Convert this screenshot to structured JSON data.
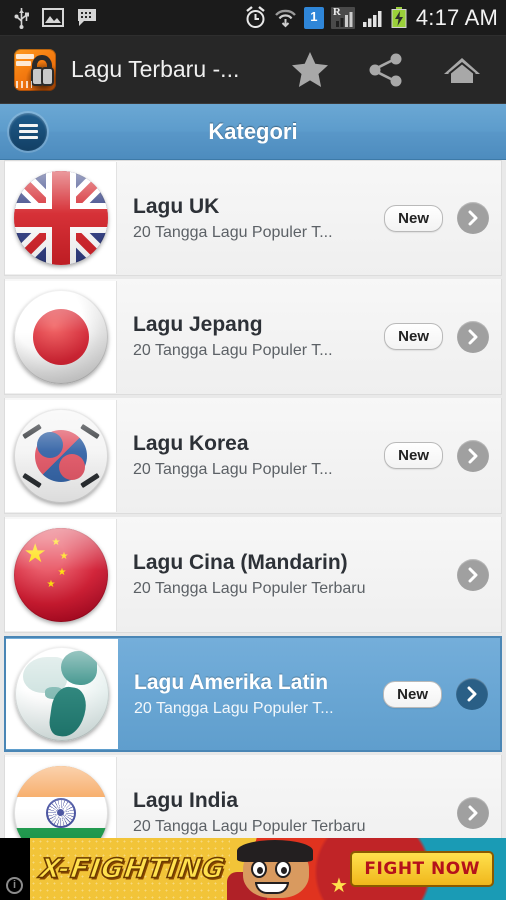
{
  "status_bar": {
    "time": "4:17 AM",
    "sim_badge": "1",
    "roaming_label": "R",
    "icons": [
      "usb-icon",
      "image-icon",
      "message-icon",
      "alarm-icon",
      "wifi-icon",
      "sim-icon",
      "roaming-signal-icon",
      "signal-icon",
      "battery-charging-icon"
    ]
  },
  "action_bar": {
    "app_title": "Lagu Terbaru -...",
    "app_icon_name": "app-logo-icon",
    "actions": [
      {
        "name": "favorite-star-button",
        "icon": "star-icon"
      },
      {
        "name": "share-button",
        "icon": "share-icon"
      },
      {
        "name": "home-button",
        "icon": "home-icon"
      }
    ]
  },
  "title_bar": {
    "title": "Kategori",
    "menu_button_label": "menu-icon"
  },
  "list": {
    "badge_label": "New",
    "items": [
      {
        "title": "Lagu UK",
        "subtitle": "20 Tangga Lagu Populer T...",
        "flag": "uk-flag-icon",
        "new": true,
        "selected": false
      },
      {
        "title": "Lagu Jepang",
        "subtitle": "20 Tangga Lagu Populer T...",
        "flag": "japan-flag-icon",
        "new": true,
        "selected": false
      },
      {
        "title": "Lagu Korea",
        "subtitle": "20 Tangga Lagu Populer T...",
        "flag": "korea-flag-icon",
        "new": true,
        "selected": false
      },
      {
        "title": "Lagu Cina (Mandarin)",
        "subtitle": "20 Tangga Lagu Populer Terbaru",
        "flag": "china-flag-icon",
        "new": false,
        "selected": false
      },
      {
        "title": "Lagu Amerika Latin",
        "subtitle": "20 Tangga Lagu Populer T...",
        "flag": "latin-america-globe-icon",
        "new": true,
        "selected": true
      },
      {
        "title": "Lagu India",
        "subtitle": "20 Tangga Lagu Populer Terbaru",
        "flag": "india-flag-icon",
        "new": false,
        "selected": false
      }
    ]
  },
  "ad_banner": {
    "logo_text": "X-FIGHTING",
    "cta_label": "FIGHT NOW",
    "info_label": "i"
  },
  "colors": {
    "title_bar_blue": "#5997c8",
    "selected_row_blue": "#5f9ecd",
    "accent_orange": "#f47b10",
    "status_bar_dark": "#1b1b1b",
    "action_bar_dark": "#272727"
  }
}
